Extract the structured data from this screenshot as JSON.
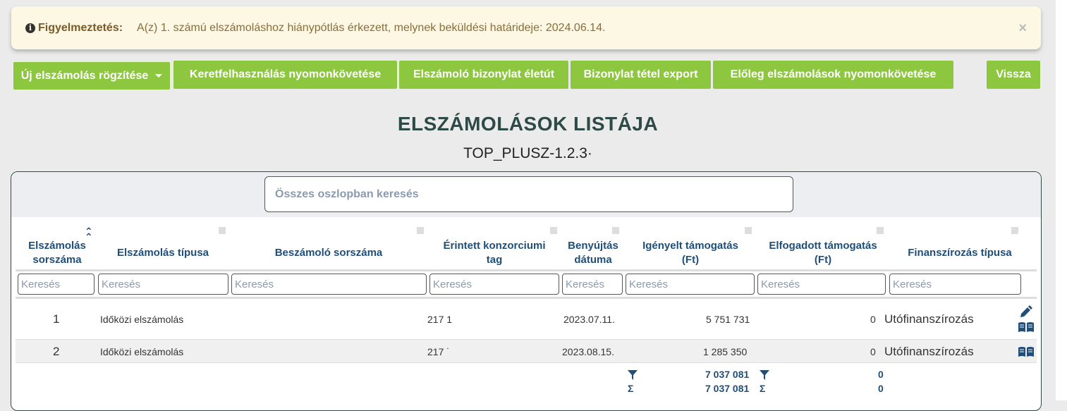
{
  "alert": {
    "label": "Figyelmeztetés:",
    "message": "A(z) 1. számú elszámoláshoz hiánypótlás érkezett, melynek beküldési határideje: 2024.06.14.",
    "close": "×"
  },
  "toolbar": {
    "new_settlement": "Új elszámolás rögzítése",
    "budget_tracking": "Keretfelhasználás nyomonkövetése",
    "document_lifecycle": "Elszámoló bizonylat életút",
    "item_export": "Bizonylat tétel export",
    "advance_tracking": "Előleg elszámolások nyomonkövetése",
    "back": "Vissza"
  },
  "page": {
    "title": "ELSZÁMOLÁSOK LISTÁJA",
    "subtitle": "TOP_PLUSZ-1.2.3·"
  },
  "table": {
    "search_placeholder": "Összes oszlopban keresés",
    "filter_placeholder": "Keresés",
    "columns": [
      {
        "line1": "Elszámolás",
        "line2": "sorszáma"
      },
      {
        "line1": "Elszámolás típusa",
        "line2": ""
      },
      {
        "line1": "Beszámoló sorszáma",
        "line2": ""
      },
      {
        "line1": "Érintett konzorciumi",
        "line2": "tag"
      },
      {
        "line1": "Benyújtás",
        "line2": "dátuma"
      },
      {
        "line1": "Igényelt támogatás",
        "line2": "(Ft)"
      },
      {
        "line1": "Elfogadott támogatás",
        "line2": "(Ft)"
      },
      {
        "line1": "Finanszírozás típusa",
        "line2": ""
      }
    ],
    "rows": [
      {
        "no": "1",
        "type": "Időközi elszámolás",
        "member": "217 1",
        "date": "2023.07.11.",
        "requested": "5 751 731",
        "accepted": "0",
        "financing": "Utófinanszírozás"
      },
      {
        "no": "2",
        "type": "Időközi elszámolás",
        "member": "217 ˙",
        "date": "2023.08.15.",
        "requested": "1 285 350",
        "accepted": "0",
        "financing": "Utófinanszírozás"
      }
    ],
    "totals": {
      "requested_filtered": "7 037 081",
      "requested_sum": "7 037 081",
      "accepted_filtered": "0",
      "accepted_sum": "0",
      "sigma": "Σ"
    }
  },
  "colors": {
    "accent_green": "#8dc63f",
    "title_dark": "#2d4a47",
    "header_blue": "#1f4e79",
    "alert_bg": "#fcf8e3"
  }
}
